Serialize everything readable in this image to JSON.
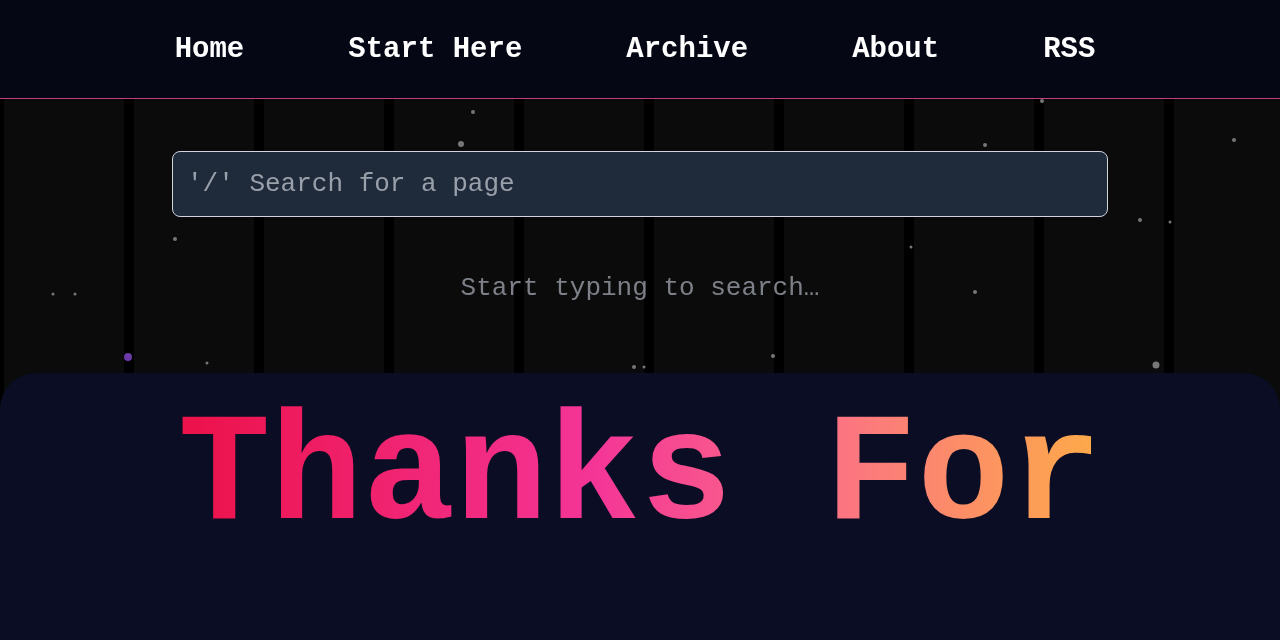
{
  "nav": {
    "links": [
      {
        "label": "Home"
      },
      {
        "label": "Start Here"
      },
      {
        "label": "Archive"
      },
      {
        "label": "About"
      },
      {
        "label": "RSS"
      }
    ]
  },
  "search": {
    "placeholder": "'/' Search for a page",
    "hint": "Start typing to search…"
  },
  "hero": {
    "title": "Thanks For"
  }
}
